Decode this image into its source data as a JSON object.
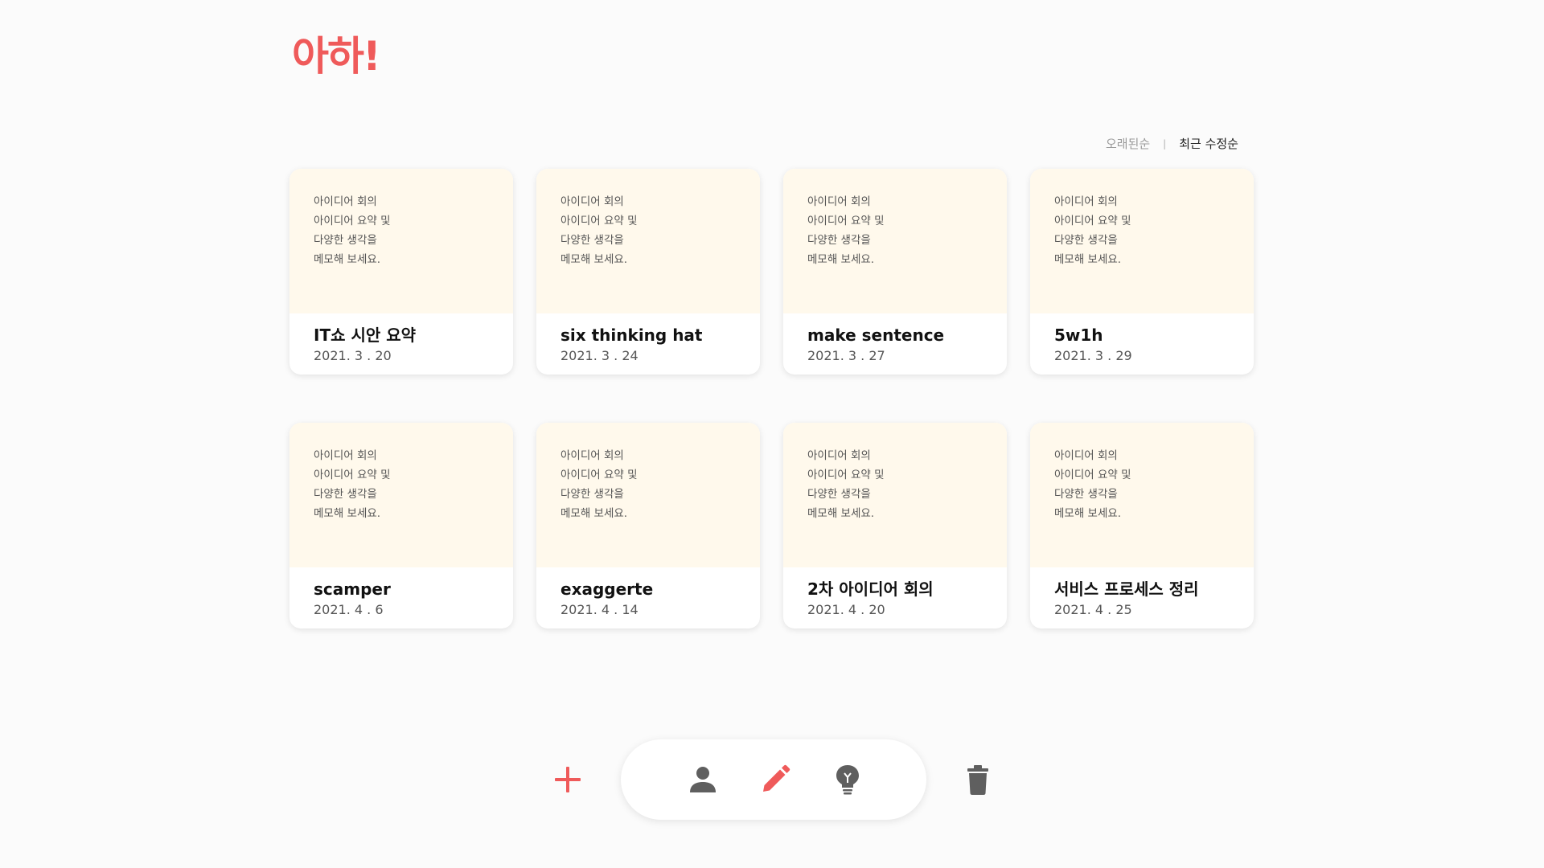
{
  "app": {
    "logo": "아하!"
  },
  "colors": {
    "brand": "#ef5a5a",
    "card_preview_bg": "#fff9ec",
    "icon_gray": "#5f5f5f"
  },
  "sort": {
    "oldest_label": "오래된순",
    "divider": "|",
    "recent_label": "최근 수정순",
    "active": "recent"
  },
  "cards": [
    {
      "preview": [
        "아이디어 회의",
        "아이디어 요약 및",
        "다양한 생각을",
        "메모해 보세요."
      ],
      "title": "IT쇼 시안 요약",
      "date": "2021. 3 . 20"
    },
    {
      "preview": [
        "아이디어 회의",
        "아이디어 요약 및",
        "다양한 생각을",
        "메모해 보세요."
      ],
      "title": "six thinking hat",
      "date": "2021. 3 . 24"
    },
    {
      "preview": [
        "아이디어 회의",
        "아이디어 요약 및",
        "다양한 생각을",
        "메모해 보세요."
      ],
      "title": "make sentence",
      "date": "2021. 3 . 27"
    },
    {
      "preview": [
        "아이디어 회의",
        "아이디어 요약 및",
        "다양한 생각을",
        "메모해 보세요."
      ],
      "title": "5w1h",
      "date": "2021. 3 . 29"
    },
    {
      "preview": [
        "아이디어 회의",
        "아이디어 요약 및",
        "다양한 생각을",
        "메모해 보세요."
      ],
      "title": "scamper",
      "date": "2021. 4 . 6"
    },
    {
      "preview": [
        "아이디어 회의",
        "아이디어 요약 및",
        "다양한 생각을",
        "메모해 보세요."
      ],
      "title": "exaggerte",
      "date": "2021. 4 . 14"
    },
    {
      "preview": [
        "아이디어 회의",
        "아이디어 요약 및",
        "다양한 생각을",
        "메모해 보세요."
      ],
      "title": "2차 아이디어 회의",
      "date": "2021. 4 . 20"
    },
    {
      "preview": [
        "아이디어 회의",
        "아이디어 요약 및",
        "다양한 생각을",
        "메모해 보세요."
      ],
      "title": "서비스 프로세스 정리",
      "date": "2021. 4 . 25"
    }
  ],
  "toolbar": {
    "add_icon": "plus-icon",
    "profile_icon": "person-icon",
    "edit_icon": "pencil-icon",
    "idea_icon": "lightbulb-icon",
    "delete_icon": "trash-icon"
  }
}
